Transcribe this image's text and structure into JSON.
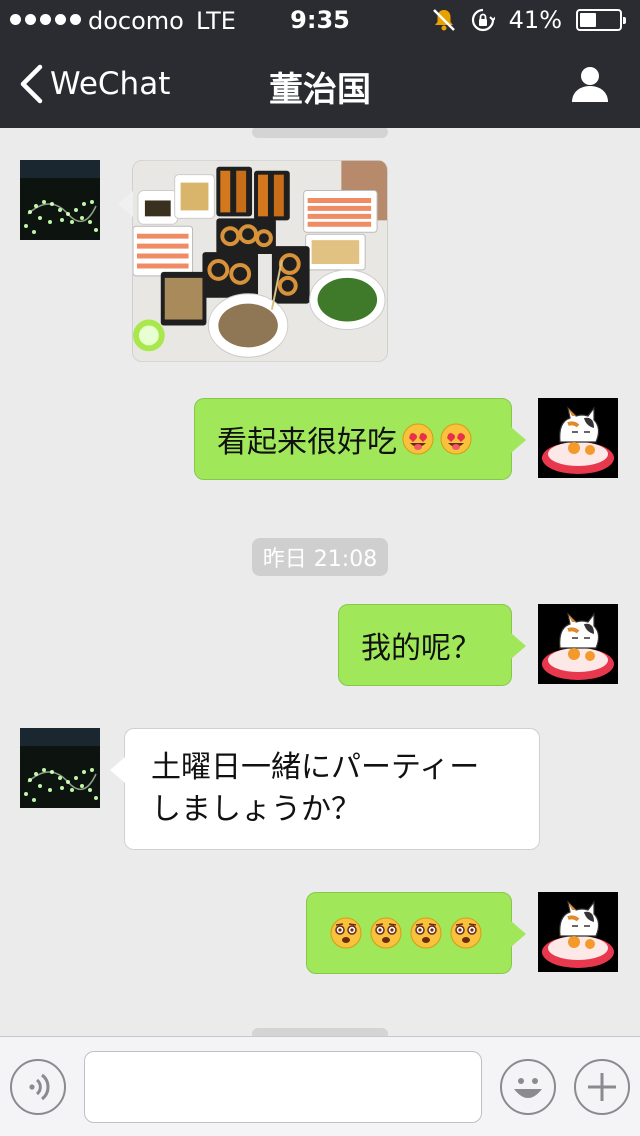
{
  "status_bar": {
    "carrier": "docomo",
    "network": "LTE",
    "time": "9:35",
    "battery_label": "41%",
    "battery_level": 0.41
  },
  "nav": {
    "back_label": "WeChat",
    "title": "董治国"
  },
  "messages": [
    {
      "side": "in",
      "type": "image",
      "content": "food-platters-photo"
    },
    {
      "side": "out",
      "type": "text",
      "text": "看起来很好吃",
      "emoji": [
        "heart-eyes-tongue-emoji",
        "heart-eyes-tongue-emoji"
      ]
    },
    {
      "side": "out",
      "type": "text",
      "text": "我的呢？"
    },
    {
      "side": "in",
      "type": "text",
      "text": "土曜日一緒にパーティー\nしましょうか？"
    },
    {
      "side": "out",
      "type": "emoji_only",
      "emoji": [
        "dizzy-face-emoji",
        "dizzy-face-emoji",
        "dizzy-face-emoji",
        "dizzy-face-emoji"
      ]
    }
  ],
  "timestamp": "昨日 21:08",
  "toolbar": {
    "input_value": "",
    "icons": [
      "voice-icon",
      "emoji-icon",
      "plus-icon"
    ]
  },
  "colors": {
    "nav_bg": "#2b2c31",
    "chat_bg": "#ebebeb",
    "out_bubble": "#a0e75a",
    "in_bubble": "#ffffff"
  }
}
